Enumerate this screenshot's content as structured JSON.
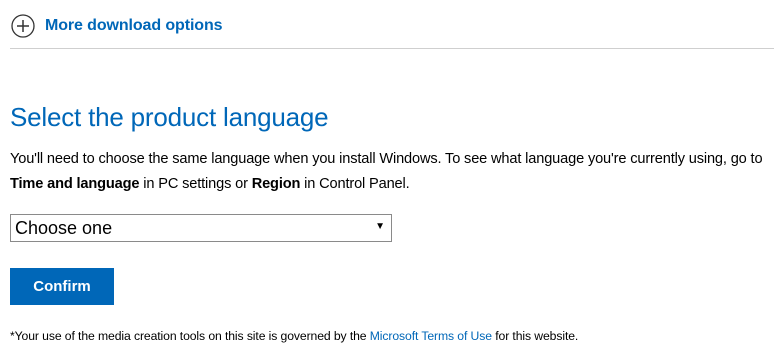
{
  "colors": {
    "accent": "#0067b8",
    "button_text": "#ffffff",
    "divider": "#cfcfcf"
  },
  "more_options": {
    "icon": "plus-circle-icon",
    "label": "More download options"
  },
  "language_section": {
    "heading": "Select the product language",
    "description": {
      "part1": "You'll need to choose the same language when you install Windows. To see what language you're currently using, go to ",
      "time_and_language": "Time and language",
      "part2": " in PC settings or ",
      "region": "Region",
      "part3": " in Control Panel."
    },
    "select": {
      "selected_value": "Choose one",
      "arrow": "▼"
    },
    "confirm_label": "Confirm"
  },
  "footnote": {
    "prefix": "*Your use of the media creation tools on this site is governed by the ",
    "link": "Microsoft Terms of Use",
    "suffix": " for this website."
  }
}
